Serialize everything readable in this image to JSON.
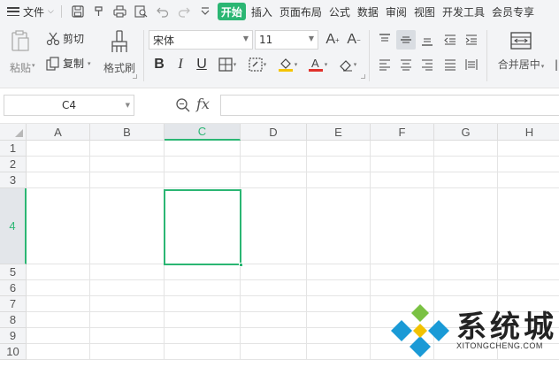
{
  "menubar": {
    "file_label": "文件",
    "tabs": [
      {
        "label": "开始",
        "active": true
      },
      {
        "label": "插入",
        "active": false
      },
      {
        "label": "页面布局",
        "active": false
      },
      {
        "label": "公式",
        "active": false
      },
      {
        "label": "数据",
        "active": false
      },
      {
        "label": "审阅",
        "active": false
      },
      {
        "label": "视图",
        "active": false
      },
      {
        "label": "开发工具",
        "active": false
      },
      {
        "label": "会员专享",
        "active": false
      }
    ],
    "quick_icons": [
      "save-icon",
      "format-painter-quick-icon",
      "print-icon",
      "print-preview-icon",
      "undo-icon",
      "redo-icon",
      "customize-chevron-icon"
    ]
  },
  "ribbon": {
    "paste_label": "粘贴",
    "cut_label": "剪切",
    "copy_label": "复制",
    "format_painter_label": "格式刷",
    "font_name": "宋体",
    "font_size": "11",
    "merge_center_label": "合并居中"
  },
  "formula_bar": {
    "name_box": "C4",
    "fx_label": "fx",
    "formula_value": ""
  },
  "grid": {
    "columns": [
      "A",
      "B",
      "C",
      "D",
      "E",
      "F",
      "G",
      "H"
    ],
    "rows": [
      "1",
      "2",
      "3",
      "4",
      "5",
      "6",
      "7",
      "8",
      "9",
      "10"
    ],
    "active_column": "C",
    "active_row": "4",
    "selected_cell": "C4"
  },
  "watermark": {
    "title": "系统城",
    "subtitle": "XITONGCHENG.COM"
  },
  "colors": {
    "accent": "#2bb673",
    "ribbon_bg": "#f3f4f6",
    "watermark_blue": "#1a9ad6",
    "watermark_green": "#7ac143"
  }
}
